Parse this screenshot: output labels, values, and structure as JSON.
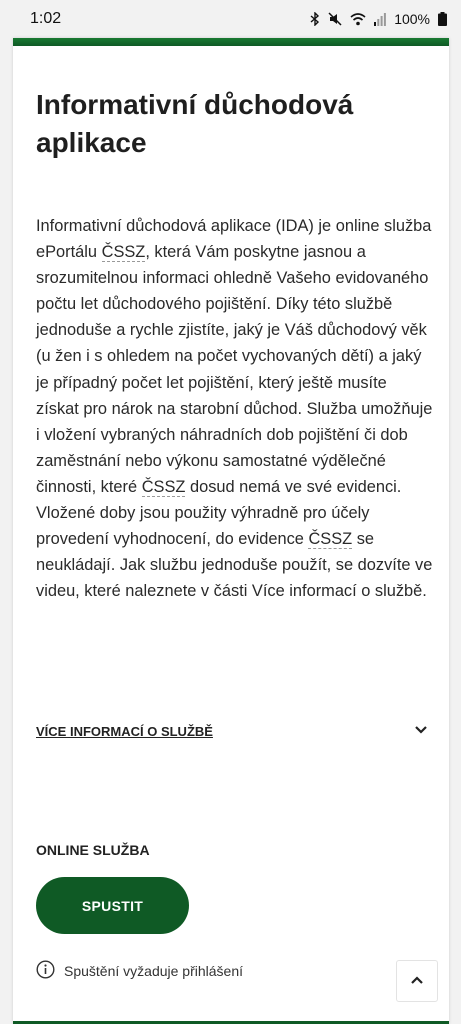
{
  "status_bar": {
    "time": "1:02",
    "battery": "100%",
    "icons": [
      "bluetooth-icon",
      "mute-icon",
      "wifi-icon",
      "signal-icon",
      "battery-icon"
    ]
  },
  "page": {
    "title_line1": "Informativní důchodová",
    "title_line2": "aplikace",
    "description": {
      "p1": "Informativní důchodová aplikace (IDA) je online služba ePortálu ",
      "abbr1": "ČSSZ",
      "p2": ", která Vám poskytne jasnou a srozumitelnou informaci ohledně Vašeho evidovaného počtu let důchodového pojištění. Díky této službě jednoduše a rychle zjistíte, jaký je Váš důchodový věk (u žen i s ohledem na počet vychovaných dětí) a jaký je případný počet let pojištění, který ještě musíte získat pro nárok na starobní důchod. Služba umožňuje i vložení vybraných náhradních dob pojištění či dob zaměstnání nebo výkonu samostatné výdělečné činnosti, které ",
      "abbr2": "ČSSZ",
      "p3": " dosud nemá ve své evidenci. Vložené doby jsou použity výhradně pro účely provedení vyhodnocení, do evidence ",
      "abbr3": "ČSSZ",
      "p4": " se neukládají. Jak službu jednoduše použít, se dozvíte ve videu, které naleznete v části Více informací o službě."
    },
    "more_info_label": "VÍCE INFORMACÍ O SLUŽBĚ",
    "online_service_label": "ONLINE SLUŽBA",
    "run_button": "SPUSTIT",
    "login_note": "Spuštění vyžaduje přihlášení"
  },
  "colors": {
    "brand_green": "#0f5a25",
    "stripe_green": "#1a7a33",
    "background": "#f2f2f2",
    "card": "#ffffff"
  }
}
